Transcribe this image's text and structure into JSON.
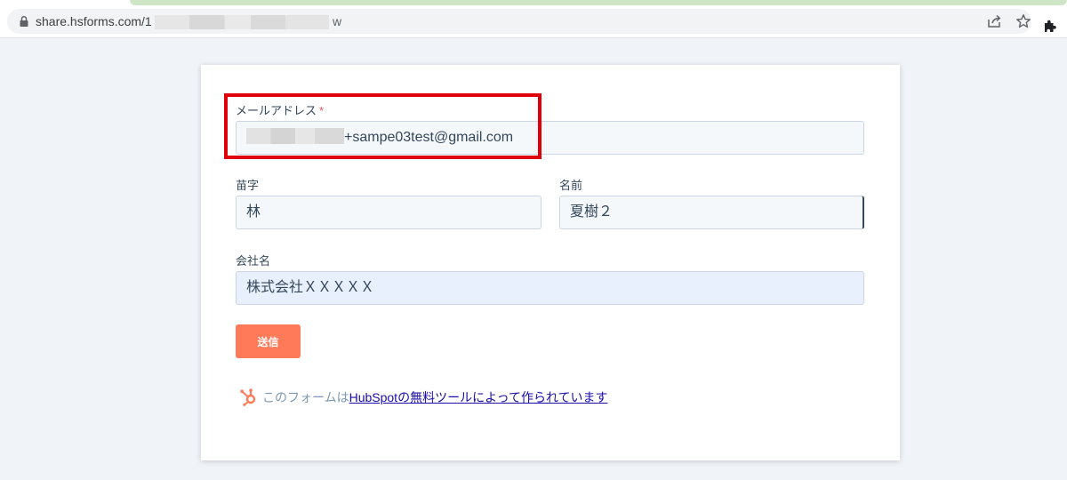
{
  "browser": {
    "url_prefix": "share.hsforms.com/1",
    "url_suffix": "w"
  },
  "form": {
    "email": {
      "label": "メールアドレス",
      "required_mark": "*",
      "value": "+sampe03test@gmail.com"
    },
    "last_name": {
      "label": "苗字",
      "value": "林"
    },
    "first_name": {
      "label": "名前",
      "value": "夏樹２"
    },
    "company": {
      "label": "会社名",
      "value": "株式会社ＸＸＸＸＸ"
    },
    "submit_label": "送信"
  },
  "footer": {
    "prefix": "このフォームは",
    "link_text": "HubSpotの無料ツールによって作られています"
  },
  "colors": {
    "submit_button": "#ff7a59",
    "highlight_border": "#e0000a",
    "hubspot_brand": "#ff7a59"
  }
}
